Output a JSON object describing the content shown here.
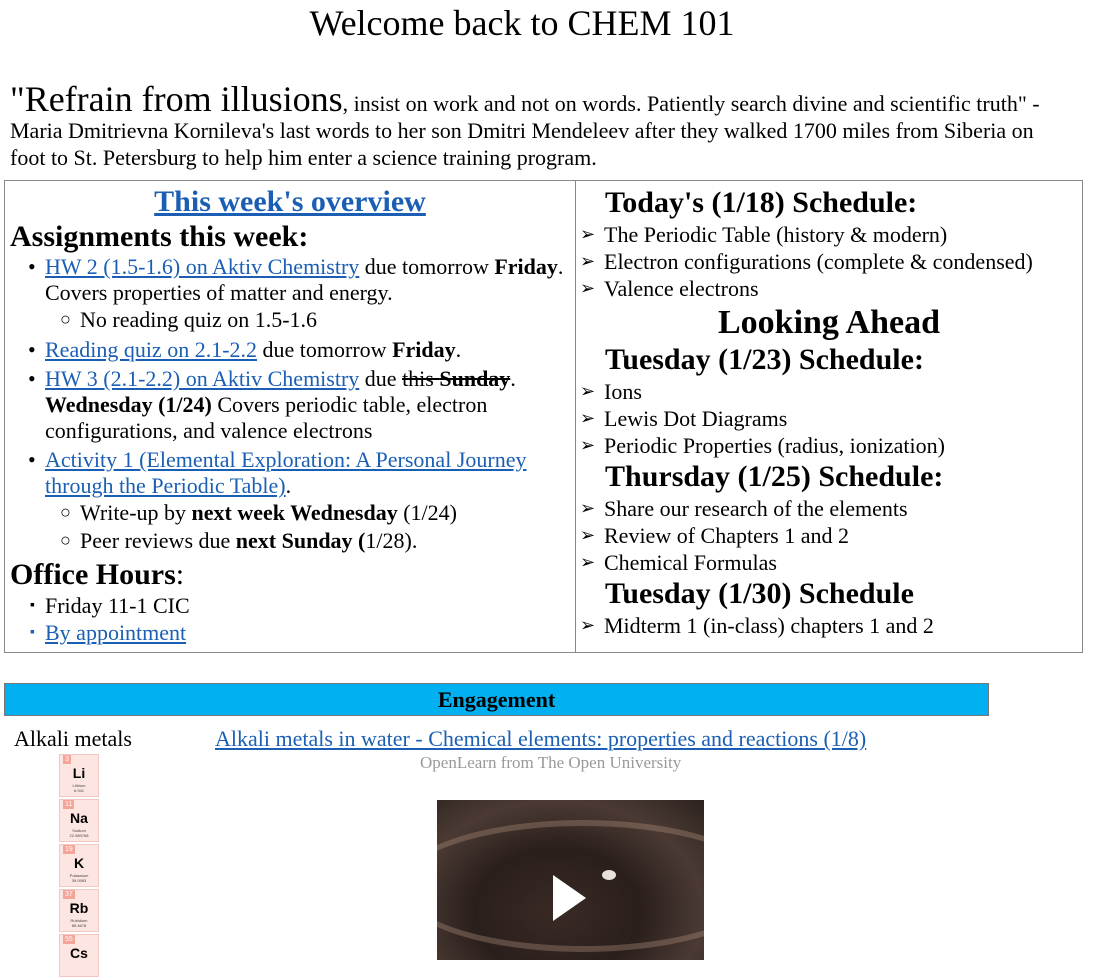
{
  "page": {
    "title": "Welcome back to CHEM 101",
    "quote_big": "\"Refrain from illusions",
    "quote_rest": ", insist on work and not on words. Patiently search divine and scientific truth\" - Maria Dmitrievna Kornileva's last words to her son Dmitri Mendeleev after they walked 1700 miles from Siberia on foot to St. Petersburg to help him enter a science training program."
  },
  "overview": {
    "heading": "This week's overview",
    "assignments_heading": "Assignments this week:",
    "hw2_link": "HW 2 (1.5-1.6) on Aktiv Chemistry",
    "hw2_due": " due tomorrow ",
    "hw2_day": "Friday",
    "hw2_desc": ". Covers properties of matter and energy.",
    "hw2_sub": "No reading quiz on 1.5-1.6",
    "rq_link": "Reading quiz on 2.1-2.2",
    "rq_due": " due tomorrow ",
    "rq_day": "Friday",
    "rq_end": ".",
    "hw3_link": "HW 3 (2.1-2.2) on Aktiv Chemistry",
    "hw3_due": " due ",
    "hw3_strike1": "this ",
    "hw3_strike2": "Sunday",
    "hw3_dot": ". ",
    "hw3_new": "Wednesday (1/24)",
    "hw3_desc": " Covers periodic table, electron configurations, and valence electrons",
    "act_link": "Activity 1 (Elemental Exploration: A Personal Journey through the Periodic Table)",
    "act_end": ".",
    "act_sub1_a": "Write-up by ",
    "act_sub1_b": "next week Wednesday",
    "act_sub1_c": " (1/24)",
    "act_sub2_a": "Peer reviews due ",
    "act_sub2_b": "next Sunday (",
    "act_sub2_c": "1/28).",
    "office_heading": "Office Hours",
    "office_colon": ":",
    "office_items": [
      "Friday 11-1 CIC",
      "By appointment"
    ]
  },
  "schedule": {
    "today_heading": "Today's (1/18) Schedule:",
    "today_items": [
      "The Periodic Table (history & modern)",
      "Electron configurations (complete & condensed)",
      "Valence electrons"
    ],
    "looking_ahead": "Looking Ahead",
    "tue_heading": "Tuesday (1/23) Schedule:",
    "tue_items": [
      "Ions",
      "Lewis Dot Diagrams",
      "Periodic Properties (radius, ionization)"
    ],
    "thu_heading": "Thursday (1/25) Schedule:",
    "thu_items": [
      "Share our research of the elements",
      "Review of Chapters 1 and 2",
      "Chemical Formulas"
    ],
    "tue2_heading": "Tuesday (1/30) Schedule",
    "tue2_items": [
      "Midterm 1 (in-class) chapters 1 and 2"
    ]
  },
  "engagement": {
    "bar_label": "Engagement",
    "topic_label": "Alkali metals",
    "elements": [
      {
        "num": "3",
        "sym": "Li",
        "name": "Lithium",
        "mass": "6.941"
      },
      {
        "num": "11",
        "sym": "Na",
        "name": "Sodium",
        "mass": "22.989768"
      },
      {
        "num": "19",
        "sym": "K",
        "name": "Potassium",
        "mass": "39.0983"
      },
      {
        "num": "37",
        "sym": "Rb",
        "name": "Rubidium",
        "mass": "85.4678"
      },
      {
        "num": "55",
        "sym": "Cs",
        "name": "",
        "mass": ""
      }
    ],
    "video_title": "Alkali metals in water - Chemical elements: properties and reactions (1/8)",
    "video_source": "OpenLearn from The Open University"
  },
  "colors": {
    "link": "#1a5fb4",
    "engagement_bar": "#00b0f0",
    "element_bg": "#fde5e2"
  },
  "icons": {
    "play": "play-icon",
    "bullet_arrow": "arrow-bullet-icon"
  }
}
